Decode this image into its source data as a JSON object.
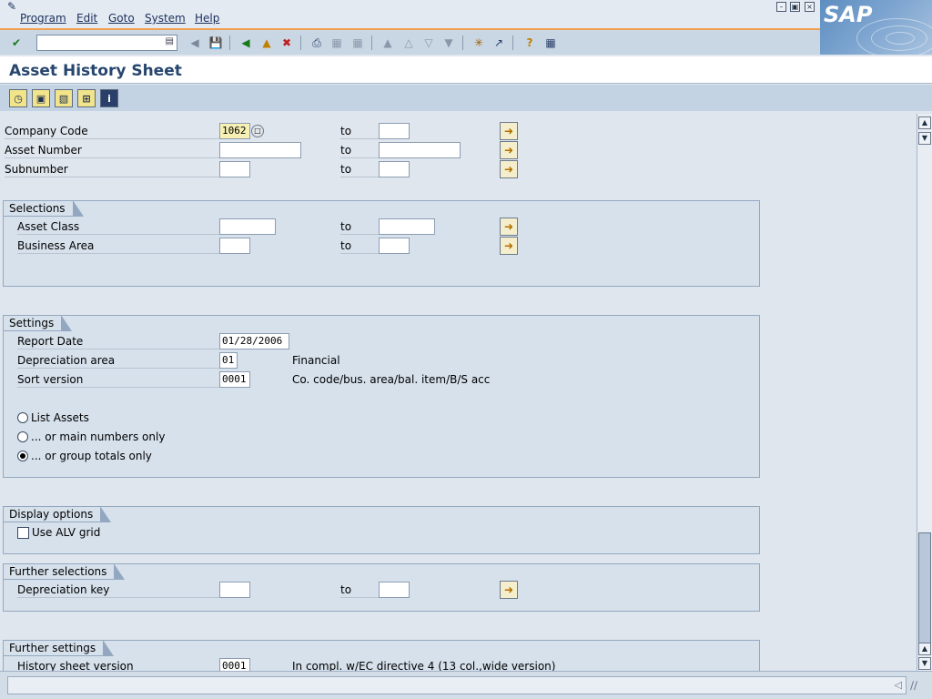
{
  "menubar": {
    "items": [
      "Program",
      "Edit",
      "Goto",
      "System",
      "Help"
    ],
    "brand": "SAP"
  },
  "toolbar": {
    "command_field_value": ""
  },
  "title": "Asset History Sheet",
  "colors": {
    "accent": "#f0a050",
    "title_text": "#27466e",
    "toolbar_bg": "#c9d6e4",
    "group_bg": "#d6e1ec"
  },
  "main_fields": [
    {
      "label": "Company Code",
      "from": "1062",
      "to_label": "to",
      "to": ""
    },
    {
      "label": "Asset Number",
      "from": "",
      "to_label": "to",
      "to": ""
    },
    {
      "label": "Subnumber",
      "from": "",
      "to_label": "to",
      "to": ""
    }
  ],
  "selections": {
    "title": "Selections",
    "fields": [
      {
        "label": "Asset Class",
        "from": "",
        "to_label": "to",
        "to": ""
      },
      {
        "label": "Business Area",
        "from": "",
        "to_label": "to",
        "to": ""
      }
    ]
  },
  "settings": {
    "title": "Settings",
    "report_date_label": "Report Date",
    "report_date": "01/28/2006",
    "dep_area_label": "Depreciation area",
    "dep_area": "01",
    "dep_area_desc": "Financial",
    "sort_label": "Sort version",
    "sort_value": "0001",
    "sort_desc": "Co. code/bus. area/bal. item/B/S acc",
    "radios": [
      {
        "label": "List Assets",
        "selected": false
      },
      {
        "label": "... or main numbers only",
        "selected": false
      },
      {
        "label": "... or group totals only",
        "selected": true
      }
    ]
  },
  "display_options": {
    "title": "Display options",
    "alv_label": "Use ALV grid",
    "alv_checked": false
  },
  "further_selections": {
    "title": "Further selections",
    "dep_key_label": "Depreciation key",
    "dep_key_from": "",
    "to_label": "to",
    "dep_key_to": ""
  },
  "further_settings": {
    "title": "Further settings",
    "hist_label": "History sheet version",
    "hist_value": "0001",
    "hist_desc": "In compl. w/EC directive 4 (13 col.,wide version)"
  },
  "status": {
    "message": ""
  }
}
